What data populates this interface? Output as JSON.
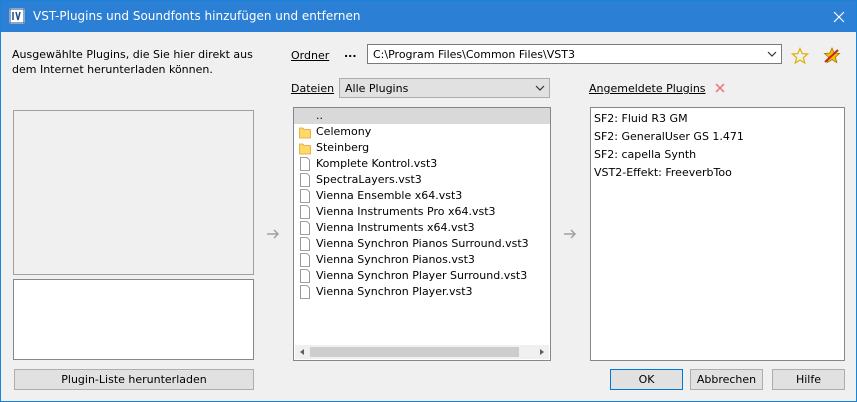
{
  "window": {
    "title": "VST-Plugins und Soundfonts hinzufügen und entfernen"
  },
  "left": {
    "description": "Ausgewählte Plugins, die Sie hier direkt aus dem Internet herunterladen können.",
    "download_button": "Plugin-Liste herunterladen"
  },
  "folder": {
    "label": "Ordner",
    "browse": "...",
    "path": "C:\\Program Files\\Common Files\\VST3"
  },
  "files": {
    "label": "Dateien",
    "filter": "Alle Plugins",
    "items": [
      {
        "name": "..",
        "type": "up"
      },
      {
        "name": "Celemony",
        "type": "folder"
      },
      {
        "name": "Steinberg",
        "type": "folder"
      },
      {
        "name": "Komplete Kontrol.vst3",
        "type": "file"
      },
      {
        "name": "SpectraLayers.vst3",
        "type": "file"
      },
      {
        "name": "Vienna Ensemble x64.vst3",
        "type": "file"
      },
      {
        "name": "Vienna Instruments Pro x64.vst3",
        "type": "file"
      },
      {
        "name": "Vienna Instruments x64.vst3",
        "type": "file"
      },
      {
        "name": "Vienna Synchron Pianos Surround.vst3",
        "type": "file"
      },
      {
        "name": "Vienna Synchron Pianos.vst3",
        "type": "file"
      },
      {
        "name": "Vienna Synchron Player Surround.vst3",
        "type": "file"
      },
      {
        "name": "Vienna Synchron Player.vst3",
        "type": "file"
      }
    ]
  },
  "registered": {
    "label": "Angemeldete Plugins",
    "items": [
      "SF2: Fluid R3 GM",
      "SF2: GeneralUser GS 1.471",
      "SF2: capella Synth",
      "VST2-Effekt: FreeverbToo"
    ]
  },
  "buttons": {
    "ok": "OK",
    "cancel": "Abbrechen",
    "help": "Hilfe"
  },
  "colors": {
    "titlebar": "#2b7fd4",
    "delete_x": "#f08080",
    "folder": "#ffd868",
    "star": "#f2c200"
  }
}
